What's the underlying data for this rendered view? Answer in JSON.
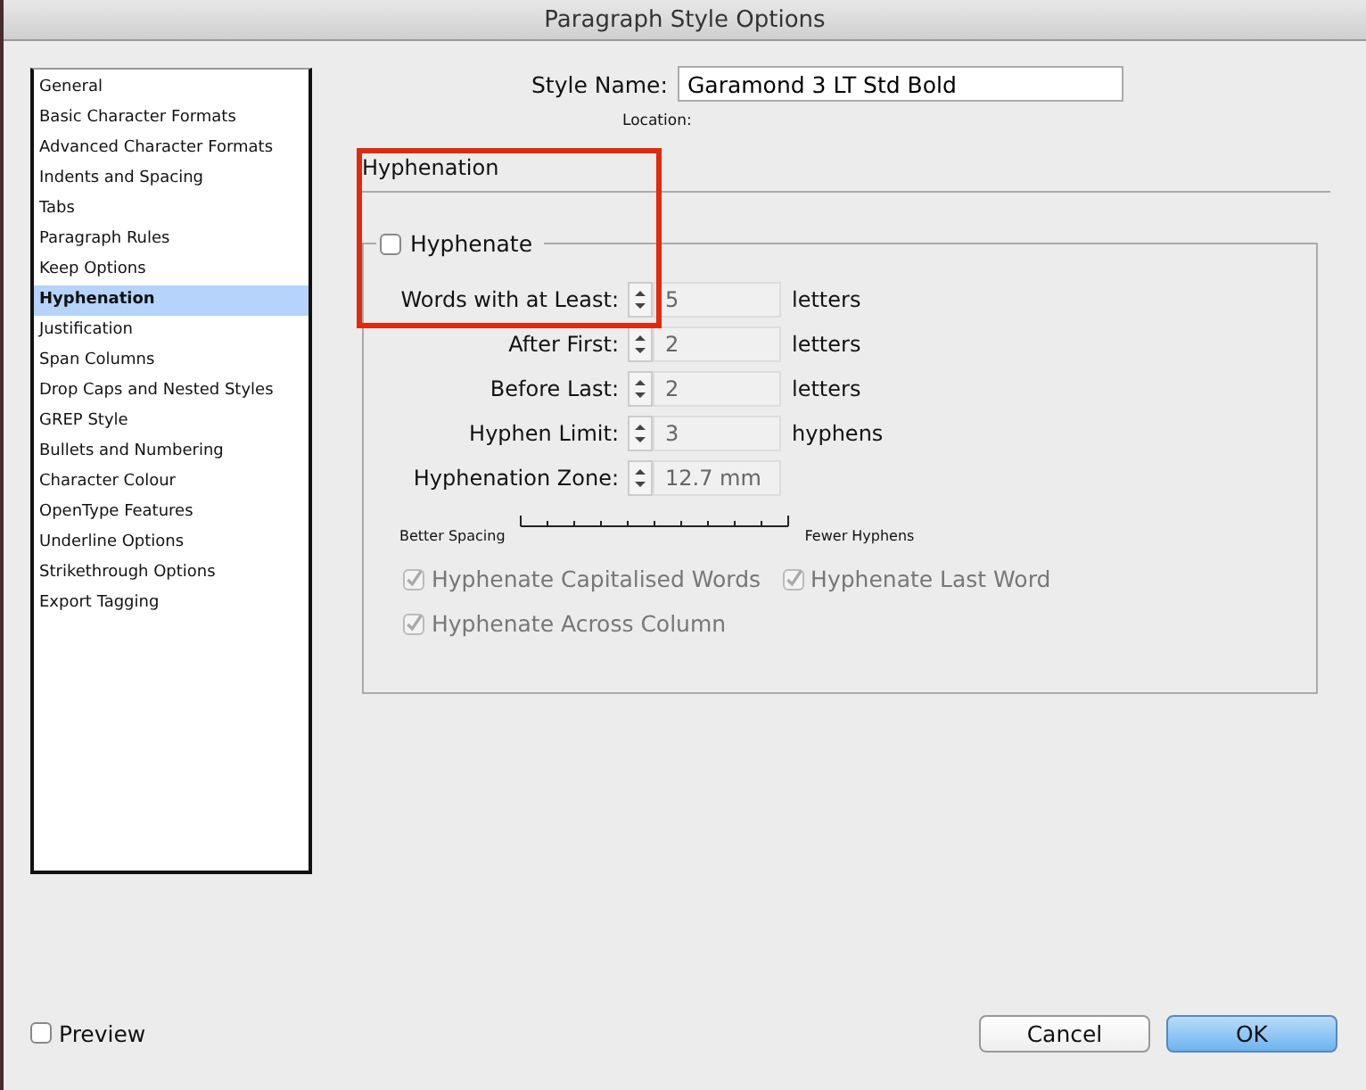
{
  "window": {
    "title": "Paragraph Style Options"
  },
  "sidebar": {
    "items": [
      {
        "label": "General",
        "selected": false
      },
      {
        "label": "Basic Character Formats",
        "selected": false
      },
      {
        "label": "Advanced Character Formats",
        "selected": false
      },
      {
        "label": "Indents and Spacing",
        "selected": false
      },
      {
        "label": "Tabs",
        "selected": false
      },
      {
        "label": "Paragraph Rules",
        "selected": false
      },
      {
        "label": "Keep Options",
        "selected": false
      },
      {
        "label": "Hyphenation",
        "selected": true
      },
      {
        "label": "Justification",
        "selected": false
      },
      {
        "label": "Span Columns",
        "selected": false
      },
      {
        "label": "Drop Caps and Nested Styles",
        "selected": false
      },
      {
        "label": "GREP Style",
        "selected": false
      },
      {
        "label": "Bullets and Numbering",
        "selected": false
      },
      {
        "label": "Character Colour",
        "selected": false
      },
      {
        "label": "OpenType Features",
        "selected": false
      },
      {
        "label": "Underline Options",
        "selected": false
      },
      {
        "label": "Strikethrough Options",
        "selected": false
      },
      {
        "label": "Export Tagging",
        "selected": false
      }
    ]
  },
  "style_name": {
    "label": "Style Name:",
    "value": "Garamond 3 LT Std Bold"
  },
  "location": {
    "label": "Location:"
  },
  "section": {
    "title": "Hyphenation"
  },
  "hyphenate": {
    "label": "Hyphenate",
    "checked": false
  },
  "fields": [
    {
      "label": "Words with at Least:",
      "value": "5",
      "unit": "letters"
    },
    {
      "label": "After First:",
      "value": "2",
      "unit": "letters"
    },
    {
      "label": "Before Last:",
      "value": "2",
      "unit": "letters"
    },
    {
      "label": "Hyphen Limit:",
      "value": "3",
      "unit": "hyphens"
    },
    {
      "label": "Hyphenation Zone:",
      "value": "12.7 mm"
    }
  ],
  "slider": {
    "left_label": "Better Spacing",
    "right_label": "Fewer Hyphens"
  },
  "options": [
    [
      {
        "label": "Hyphenate Capitalised Words",
        "checked": true,
        "disabled": true
      },
      {
        "label": "Hyphenate Last Word",
        "checked": true,
        "disabled": true
      }
    ],
    [
      {
        "label": "Hyphenate Across Column",
        "checked": true,
        "disabled": true
      }
    ]
  ],
  "preview": {
    "label": "Preview",
    "checked": false
  },
  "buttons": [
    {
      "label": "Cancel",
      "kind": "secondary"
    },
    {
      "label": "OK",
      "kind": "primary"
    }
  ]
}
